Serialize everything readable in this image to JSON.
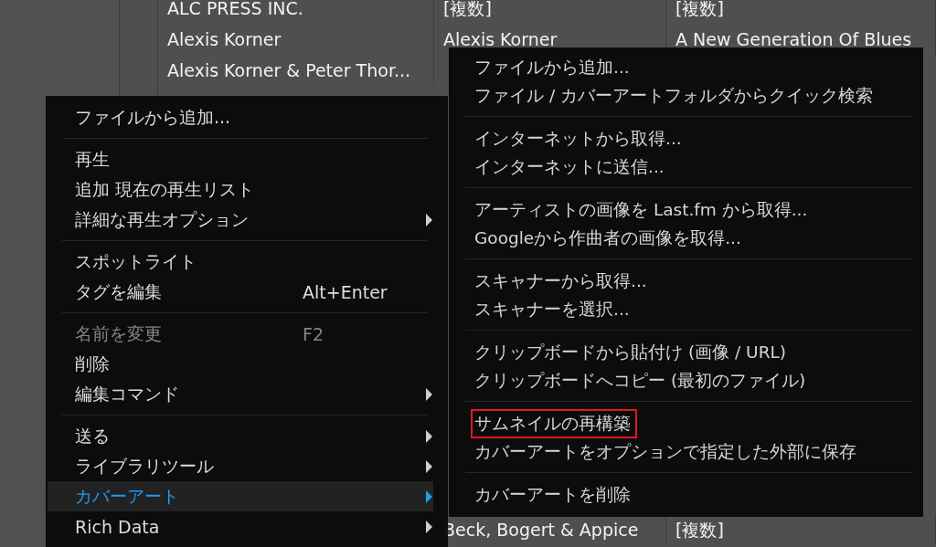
{
  "table": {
    "rows": [
      {
        "cells": [
          "ALC PRESS INC.",
          "[複数]",
          "[複数]"
        ]
      },
      {
        "cells": [
          "Alexis Korner",
          "Alexis Korner",
          "A New Generation Of Blues"
        ]
      },
      {
        "cells": [
          "Alexis Korner & Peter Thor..."
        ]
      }
    ],
    "bottom_row": {
      "cells": [
        "Beck, Bogert & Appice",
        "[複数]"
      ]
    }
  },
  "context_menu": {
    "groups": [
      [
        {
          "label": "ファイルから追加...",
          "submenu": false,
          "disabled": false,
          "selected": false
        }
      ],
      [
        {
          "label": "再生",
          "submenu": false,
          "disabled": false,
          "selected": false
        },
        {
          "label": "追加 現在の再生リスト",
          "submenu": false,
          "disabled": false,
          "selected": false
        },
        {
          "label": "詳細な再生オプション",
          "submenu": true,
          "disabled": false,
          "selected": false
        }
      ],
      [
        {
          "label": "スポットライト",
          "submenu": false,
          "disabled": false,
          "selected": false
        },
        {
          "label": "タグを編集",
          "shortcut": "Alt+Enter",
          "submenu": false,
          "disabled": false,
          "selected": false
        }
      ],
      [
        {
          "label": "名前を変更",
          "shortcut": "F2",
          "submenu": false,
          "disabled": true,
          "selected": false
        },
        {
          "label": "削除",
          "submenu": false,
          "disabled": false,
          "selected": false
        },
        {
          "label": "編集コマンド",
          "submenu": true,
          "disabled": false,
          "selected": false
        }
      ],
      [
        {
          "label": "送る",
          "submenu": true,
          "disabled": false,
          "selected": false
        },
        {
          "label": "ライブラリツール",
          "submenu": true,
          "disabled": false,
          "selected": false
        },
        {
          "label": "カバーアート",
          "submenu": true,
          "disabled": false,
          "selected": true
        },
        {
          "label": "Rich Data",
          "submenu": true,
          "disabled": false,
          "selected": false
        }
      ]
    ]
  },
  "submenu": {
    "groups": [
      [
        {
          "label": "ファイルから追加...",
          "annotated": false
        },
        {
          "label": "ファイル / カバーアートフォルダからクイック検索",
          "annotated": false
        }
      ],
      [
        {
          "label": "インターネットから取得...",
          "annotated": false
        },
        {
          "label": "インターネットに送信...",
          "annotated": false
        }
      ],
      [
        {
          "label": "アーティストの画像を Last.fm から取得...",
          "annotated": false
        },
        {
          "label": "Googleから作曲者の画像を取得...",
          "annotated": false
        }
      ],
      [
        {
          "label": "スキャナーから取得...",
          "annotated": false
        },
        {
          "label": "スキャナーを選択...",
          "annotated": false
        }
      ],
      [
        {
          "label": "クリップボードから貼付け (画像 / URL)",
          "annotated": false
        },
        {
          "label": "クリップボードへコピー (最初のファイル)",
          "annotated": false
        }
      ],
      [
        {
          "label": "サムネイルの再構築",
          "annotated": true
        },
        {
          "label": "カバーアートをオプションで指定した外部に保存",
          "annotated": false
        }
      ],
      [
        {
          "label": "カバーアートを削除",
          "annotated": false
        }
      ]
    ]
  }
}
